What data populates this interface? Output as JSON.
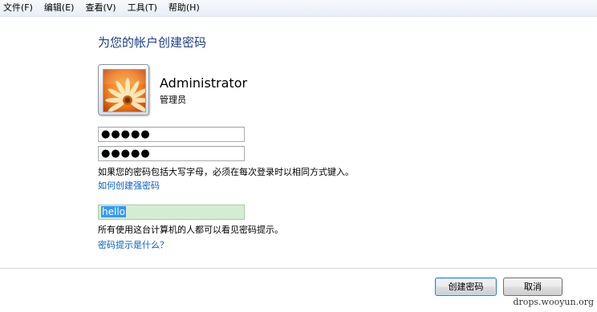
{
  "menu": [
    {
      "label": "文件(F)"
    },
    {
      "label": "编辑(E)"
    },
    {
      "label": "查看(V)"
    },
    {
      "label": "工具(T)"
    },
    {
      "label": "帮助(H)"
    }
  ],
  "page": {
    "title": "为您的帐户创建密码"
  },
  "account": {
    "name": "Administrator",
    "role": "管理员",
    "picture_icon": "flower-picture"
  },
  "form": {
    "password_mask": "●●●●●",
    "confirm_mask": "●●●●●",
    "caps_note": "如果您的密码包括大写字母，必须在每次登录时以相同方式键入。",
    "strong_password_link": "如何创建强密码",
    "hint_value": "hello",
    "hint_visibility_note": "所有使用这台计算机的人都可以看见密码提示。",
    "hint_help_link": "密码提示是什么？"
  },
  "buttons": {
    "create": "创建密码",
    "cancel": "取消"
  },
  "watermark": "drops.wooyun.org",
  "colors": {
    "title": "#1e3f8a",
    "link": "#0b5fc2",
    "hint_field_bg": "#d4edd2",
    "selection": "#3399ff"
  }
}
